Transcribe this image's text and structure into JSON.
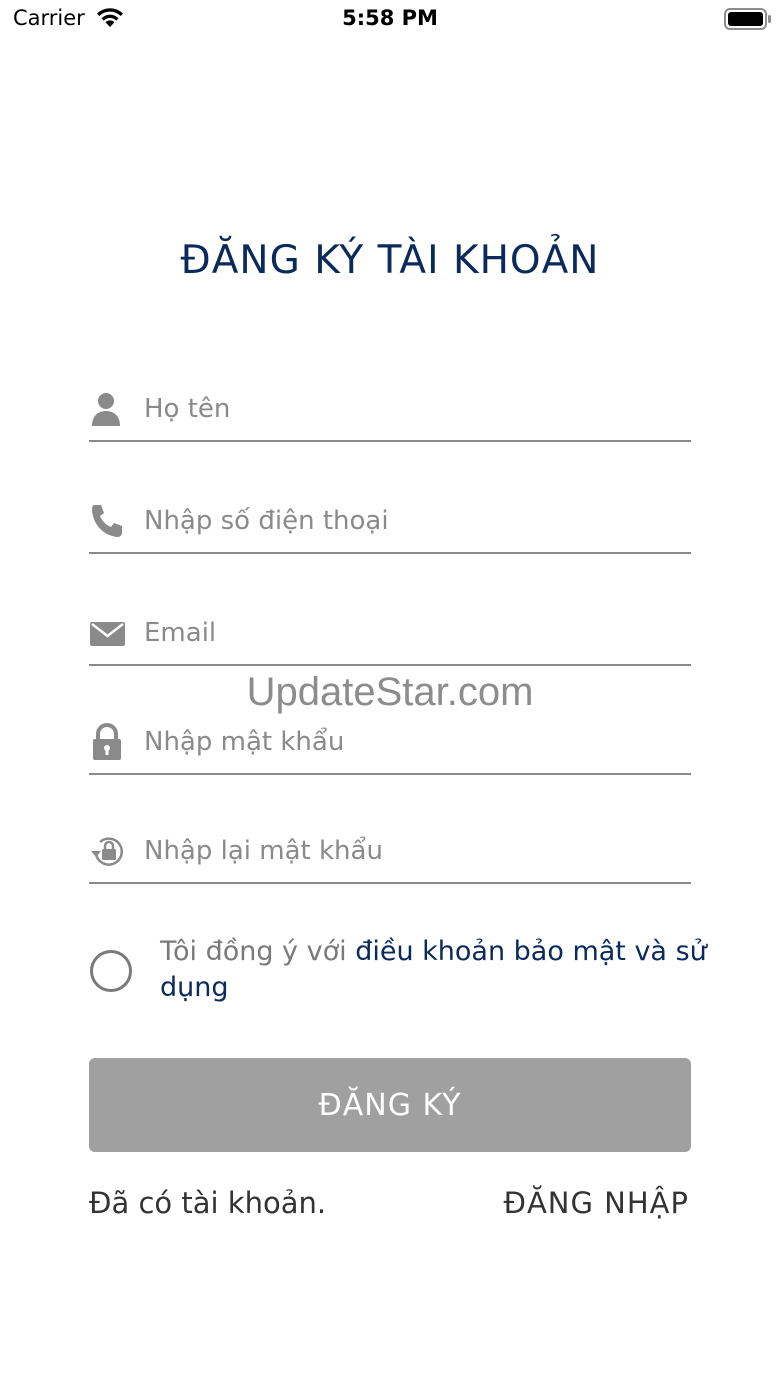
{
  "status_bar": {
    "carrier": "Carrier",
    "time": "5:58 PM"
  },
  "title": "ĐĂNG KÝ TÀI KHOẢN",
  "fields": {
    "name": {
      "placeholder": "Họ tên",
      "icon": "person-icon"
    },
    "phone": {
      "placeholder": "Nhập số điện thoại",
      "icon": "phone-icon"
    },
    "email": {
      "placeholder": "Email",
      "icon": "mail-icon"
    },
    "password": {
      "placeholder": "Nhập mật khẩu",
      "icon": "lock-icon"
    },
    "confirm_password": {
      "placeholder": "Nhập lại mật khẩu",
      "icon": "lock-reset-icon"
    }
  },
  "watermark": "UpdateStar.com",
  "terms": {
    "prefix": "Tôi đồng ý với ",
    "link": "điều khoản bảo mật và sử dụng"
  },
  "register_button": "ĐĂNG KÝ",
  "footer": {
    "have_account": "Đã có tài khoản.",
    "login": "ĐĂNG NHẬP"
  },
  "colors": {
    "title": "#0a2a5c",
    "link": "#0a2a5c",
    "button_disabled": "#a0a0a0",
    "underline": "#8a8a8a",
    "icon": "#8a8a8a"
  }
}
